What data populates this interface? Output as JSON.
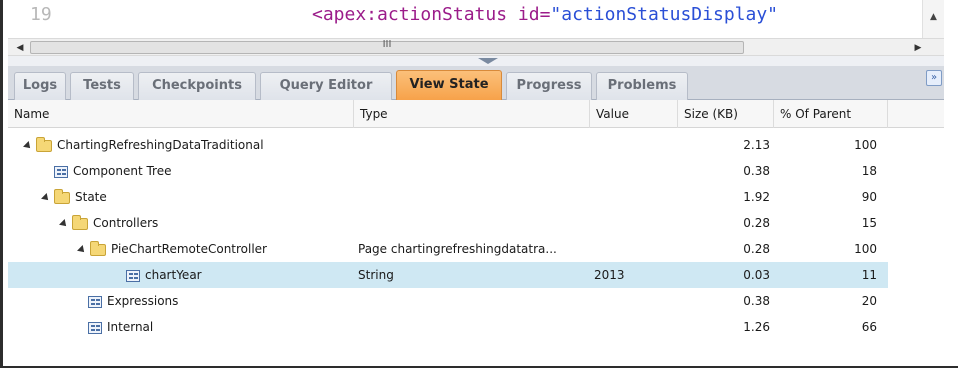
{
  "editor": {
    "line_number": "19",
    "code_tag": "<apex:actionStatus ",
    "code_attr": "id=",
    "code_value": "\"actionStatusDisplay\""
  },
  "scrollbar": {
    "grip": "III"
  },
  "tabs": [
    {
      "label": "Logs",
      "active": false
    },
    {
      "label": "Tests",
      "active": false
    },
    {
      "label": "Checkpoints",
      "active": false
    },
    {
      "label": "Query Editor",
      "active": false
    },
    {
      "label": "View State",
      "active": true
    },
    {
      "label": "Progress",
      "active": false
    },
    {
      "label": "Problems",
      "active": false
    }
  ],
  "table": {
    "columns": [
      "Name",
      "Type",
      "Value",
      "Size (KB)",
      "% Of Parent"
    ],
    "rows": [
      {
        "name": "ChartingRefreshingDataTraditional",
        "icon": "folder-icon",
        "expanded": true,
        "type": "",
        "value": "",
        "size": "2.13",
        "pct": "100",
        "selected": false
      },
      {
        "name": "Component Tree",
        "icon": "node-icon",
        "expanded": false,
        "type": "",
        "value": "",
        "size": "0.38",
        "pct": "18",
        "selected": false
      },
      {
        "name": "State",
        "icon": "folder-icon",
        "expanded": true,
        "type": "",
        "value": "",
        "size": "1.92",
        "pct": "90",
        "selected": false
      },
      {
        "name": "Controllers",
        "icon": "folder-icon",
        "expanded": true,
        "type": "",
        "value": "",
        "size": "0.28",
        "pct": "15",
        "selected": false
      },
      {
        "name": "PieChartRemoteController",
        "icon": "folder-icon",
        "expanded": true,
        "type": "Page chartingrefreshingdatatra...",
        "value": "",
        "size": "0.28",
        "pct": "100",
        "selected": false
      },
      {
        "name": "chartYear",
        "icon": "node-icon",
        "expanded": false,
        "type": "String",
        "value": "2013",
        "size": "0.03",
        "pct": "11",
        "selected": true
      },
      {
        "name": "Expressions",
        "icon": "node-icon",
        "expanded": false,
        "type": "",
        "value": "",
        "size": "0.38",
        "pct": "20",
        "selected": false
      },
      {
        "name": "Internal",
        "icon": "node-icon",
        "expanded": false,
        "type": "",
        "value": "",
        "size": "1.26",
        "pct": "66",
        "selected": false
      }
    ]
  },
  "colors": {
    "active_tab": "#f7a24a",
    "selected_row": "#cfe8f3",
    "folder": "#f5d776"
  }
}
